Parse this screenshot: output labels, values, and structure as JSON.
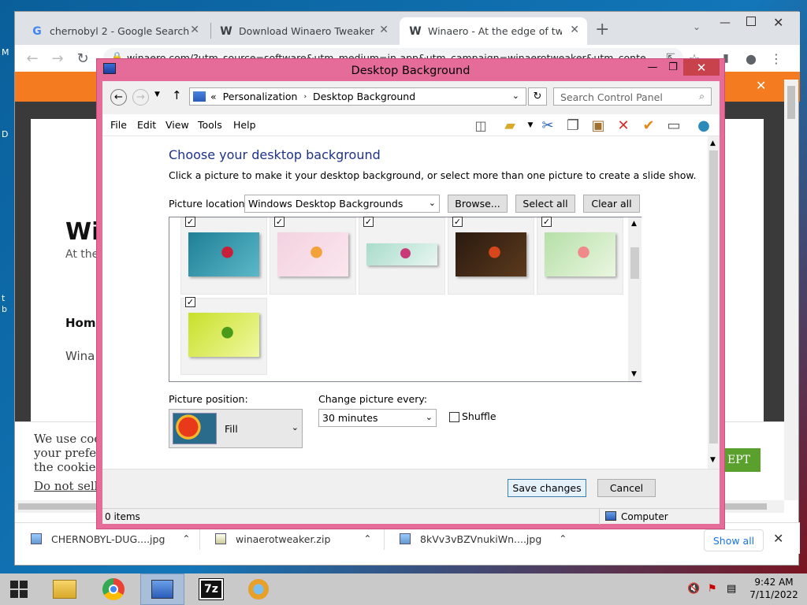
{
  "desktop": {
    "side_texts": [
      "M",
      "D",
      "t",
      "b"
    ]
  },
  "browser": {
    "tabs": [
      {
        "title": "chernobyl 2 - Google Search",
        "favicon": "G"
      },
      {
        "title": "Download Winaero Tweaker",
        "favicon": "W"
      },
      {
        "title": "Winaero - At the edge of tweakin",
        "favicon": "W",
        "active": true
      }
    ],
    "new_tab": "+",
    "url": "winaero.com/?utm_source=software&utm_medium=in-app&utm_campaign=winaerotweaker&utm_conte",
    "page": {
      "title_partial": "Wi",
      "subtitle_partial": "At the",
      "nav_partial": "Hom",
      "body_partial": "Wina"
    },
    "cookie": {
      "line1": "We use coo",
      "line2": "your prefer",
      "line3": "the cookies",
      "link": "Do not sell",
      "accept_partial": "EPT"
    },
    "downloads": [
      {
        "name": "CHERNOBYL-DUG....jpg"
      },
      {
        "name": "winaerotweaker.zip"
      },
      {
        "name": "8kVv3vBZVnukiWn....jpg"
      }
    ],
    "show_all": "Show all"
  },
  "dialog": {
    "title": "Desktop Background",
    "breadcrumb": [
      "Personalization",
      "Desktop Background"
    ],
    "breadcrumb_prefix": "«",
    "search_placeholder": "Search Control Panel",
    "menu": [
      "File",
      "Edit",
      "View",
      "Tools",
      "Help"
    ],
    "heading": "Choose your desktop background",
    "subheading": "Click a picture to make it your desktop background, or select more than one picture to create a slide show.",
    "picture_location_label": "Picture location:",
    "picture_location_value": "Windows Desktop Backgrounds",
    "browse_label": "Browse...",
    "select_all_label": "Select all",
    "clear_all_label": "Clear all",
    "images": [
      {
        "checked": true,
        "colors": [
          "#1e7f96",
          "#5cb8c8",
          "#c8203a"
        ]
      },
      {
        "checked": true,
        "colors": [
          "#f3d2e0",
          "#fbe6ee",
          "#f3a23a"
        ]
      },
      {
        "checked": true,
        "colors": [
          "#a8dccb",
          "#e8f6f0",
          "#c83a78"
        ]
      },
      {
        "checked": true,
        "colors": [
          "#2a1a10",
          "#5c3a1c",
          "#d8461c"
        ]
      },
      {
        "checked": true,
        "colors": [
          "#b6e0a8",
          "#eaf6e0",
          "#f08a8a"
        ]
      },
      {
        "checked": true,
        "colors": [
          "#c8e02a",
          "#f0f8a0",
          "#4a9a1a"
        ]
      }
    ],
    "picture_position_label": "Picture position:",
    "picture_position_value": "Fill",
    "change_every_label": "Change picture every:",
    "change_every_value": "30 minutes",
    "shuffle_label": "Shuffle",
    "shuffle_checked": false,
    "save_label": "Save changes",
    "cancel_label": "Cancel",
    "status_items": "0 items",
    "status_location": "Computer"
  },
  "taskbar": {
    "time": "9:42 AM",
    "date": "7/11/2022",
    "apps": [
      "file-explorer-icon",
      "chrome-icon",
      "control-panel-icon",
      "7zip-icon",
      "app-icon"
    ]
  }
}
